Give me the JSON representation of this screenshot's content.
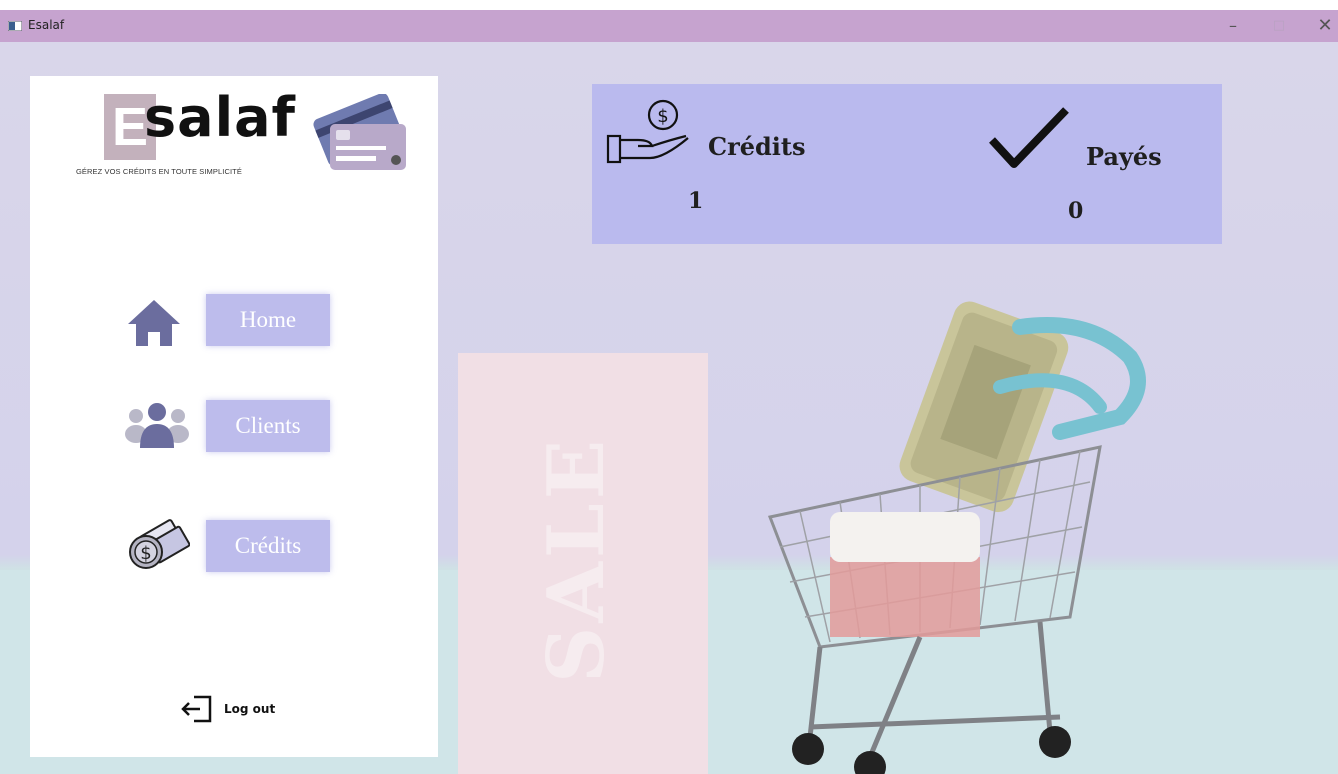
{
  "window": {
    "title": "Esalaf",
    "controls": {
      "minimize": "–",
      "maximize": "□",
      "close": "✕"
    }
  },
  "logo": {
    "letter": "E",
    "word": "salaf",
    "tagline": "GÉREZ VOS CRÉDITS EN TOUTE SIMPLICITÉ",
    "icon": "credit-cards-icon"
  },
  "nav": {
    "home": {
      "label": "Home",
      "icon": "home-icon"
    },
    "clients": {
      "label": "Clients",
      "icon": "users-icon"
    },
    "credits": {
      "label": "Crédits",
      "icon": "money-icon"
    }
  },
  "logout": {
    "label": "Log out",
    "icon": "logout-icon"
  },
  "stats": {
    "credits": {
      "label": "Crédits",
      "value": "1",
      "icon": "hand-coin-icon"
    },
    "paid": {
      "label": "Payés",
      "value": "0",
      "icon": "checkmark-icon"
    }
  },
  "background": {
    "sale_text": "SALE"
  },
  "colors": {
    "titlebar": "#c6a3cf",
    "nav_button": "#bdbcec",
    "stats_panel": "#babaee",
    "icon_purple": "#6b6d9e"
  }
}
